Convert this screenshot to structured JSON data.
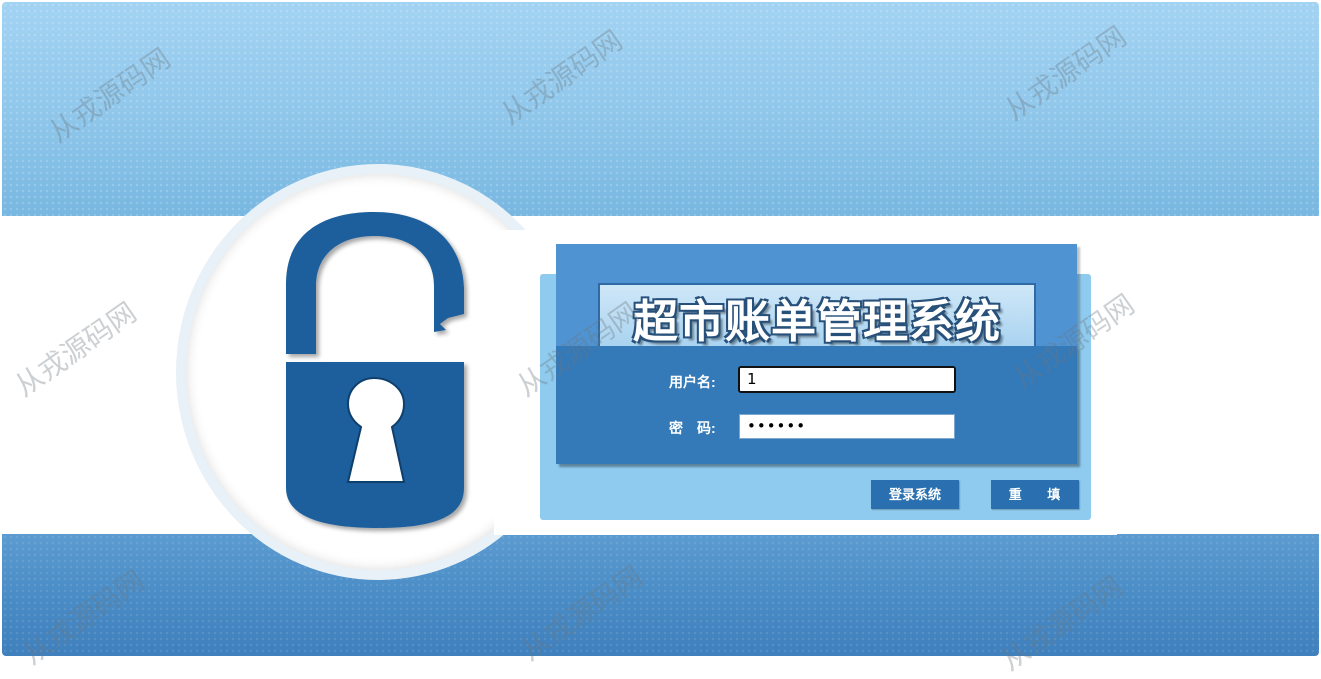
{
  "app": {
    "title": "超市账单管理系统"
  },
  "login_form": {
    "username_label": "用户名:",
    "username_value": "1",
    "password_label": "密　码:",
    "password_value": "••••••",
    "login_button": "登录系统",
    "reset_button": "重 填"
  },
  "watermarks": [
    "从戎源码网",
    "从戎源码网",
    "从戎源码网",
    "从戎源码网",
    "从戎源码网",
    "从戎源码网",
    "从戎源码网",
    "从戎源码网",
    "从戎源码网"
  ],
  "colors": {
    "panel_top": "#4f93d2",
    "panel_bottom": "#3479b8",
    "lock": "#1f5f9c",
    "button": "#2a70b0"
  }
}
